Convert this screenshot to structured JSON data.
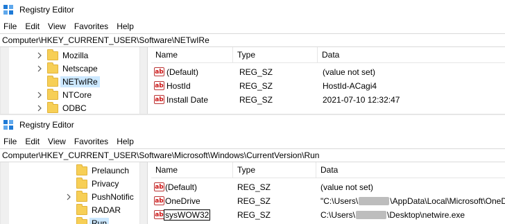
{
  "top": {
    "title": "Registry Editor",
    "menu": [
      "File",
      "Edit",
      "View",
      "Favorites",
      "Help"
    ],
    "address": "Computer\\HKEY_CURRENT_USER\\Software\\NETwIRe",
    "tree": [
      {
        "label": "Mozilla",
        "chevron": true
      },
      {
        "label": "Netscape",
        "chevron": true
      },
      {
        "label": "NETwIRe",
        "chevron": false,
        "selected": true
      },
      {
        "label": "NTCore",
        "chevron": true
      },
      {
        "label": "ODBC",
        "chevron": true
      }
    ],
    "columns": [
      "Name",
      "Type",
      "Data"
    ],
    "rows": [
      {
        "name": "(Default)",
        "type": "REG_SZ",
        "data": "(value not set)"
      },
      {
        "name": "HostId",
        "type": "REG_SZ",
        "data": "HostId-ACagi4"
      },
      {
        "name": "Install Date",
        "type": "REG_SZ",
        "data": "2021-07-10 12:32:47"
      }
    ]
  },
  "bottom": {
    "title": "Registry Editor",
    "menu": [
      "File",
      "Edit",
      "View",
      "Favorites",
      "Help"
    ],
    "address": "Computer\\HKEY_CURRENT_USER\\Software\\Microsoft\\Windows\\CurrentVersion\\Run",
    "tree": [
      {
        "label": "Prelaunch",
        "chevron": false
      },
      {
        "label": "Privacy",
        "chevron": false
      },
      {
        "label": "PushNotific",
        "chevron": true
      },
      {
        "label": "RADAR",
        "chevron": false
      },
      {
        "label": "Run",
        "chevron": false,
        "selected": true
      }
    ],
    "columns": [
      "Name",
      "Type",
      "Data"
    ],
    "rows": [
      {
        "name": "(Default)",
        "type": "REG_SZ",
        "data_pre": "(value not set)",
        "data_post": ""
      },
      {
        "name": "OneDrive",
        "type": "REG_SZ",
        "data_pre": "\"C:\\Users\\",
        "data_post": "\\AppData\\Local\\Microsoft\\OneD"
      },
      {
        "name": "sysWOW32",
        "type": "REG_SZ",
        "data_pre": "C:\\Users\\",
        "data_post": "\\Desktop\\netwire.exe",
        "editing": true
      }
    ]
  },
  "icons": {
    "app": "registry-editor-icon",
    "value": "string-value-icon",
    "folder": "folder-icon",
    "chevron": "chevron-right-icon"
  }
}
